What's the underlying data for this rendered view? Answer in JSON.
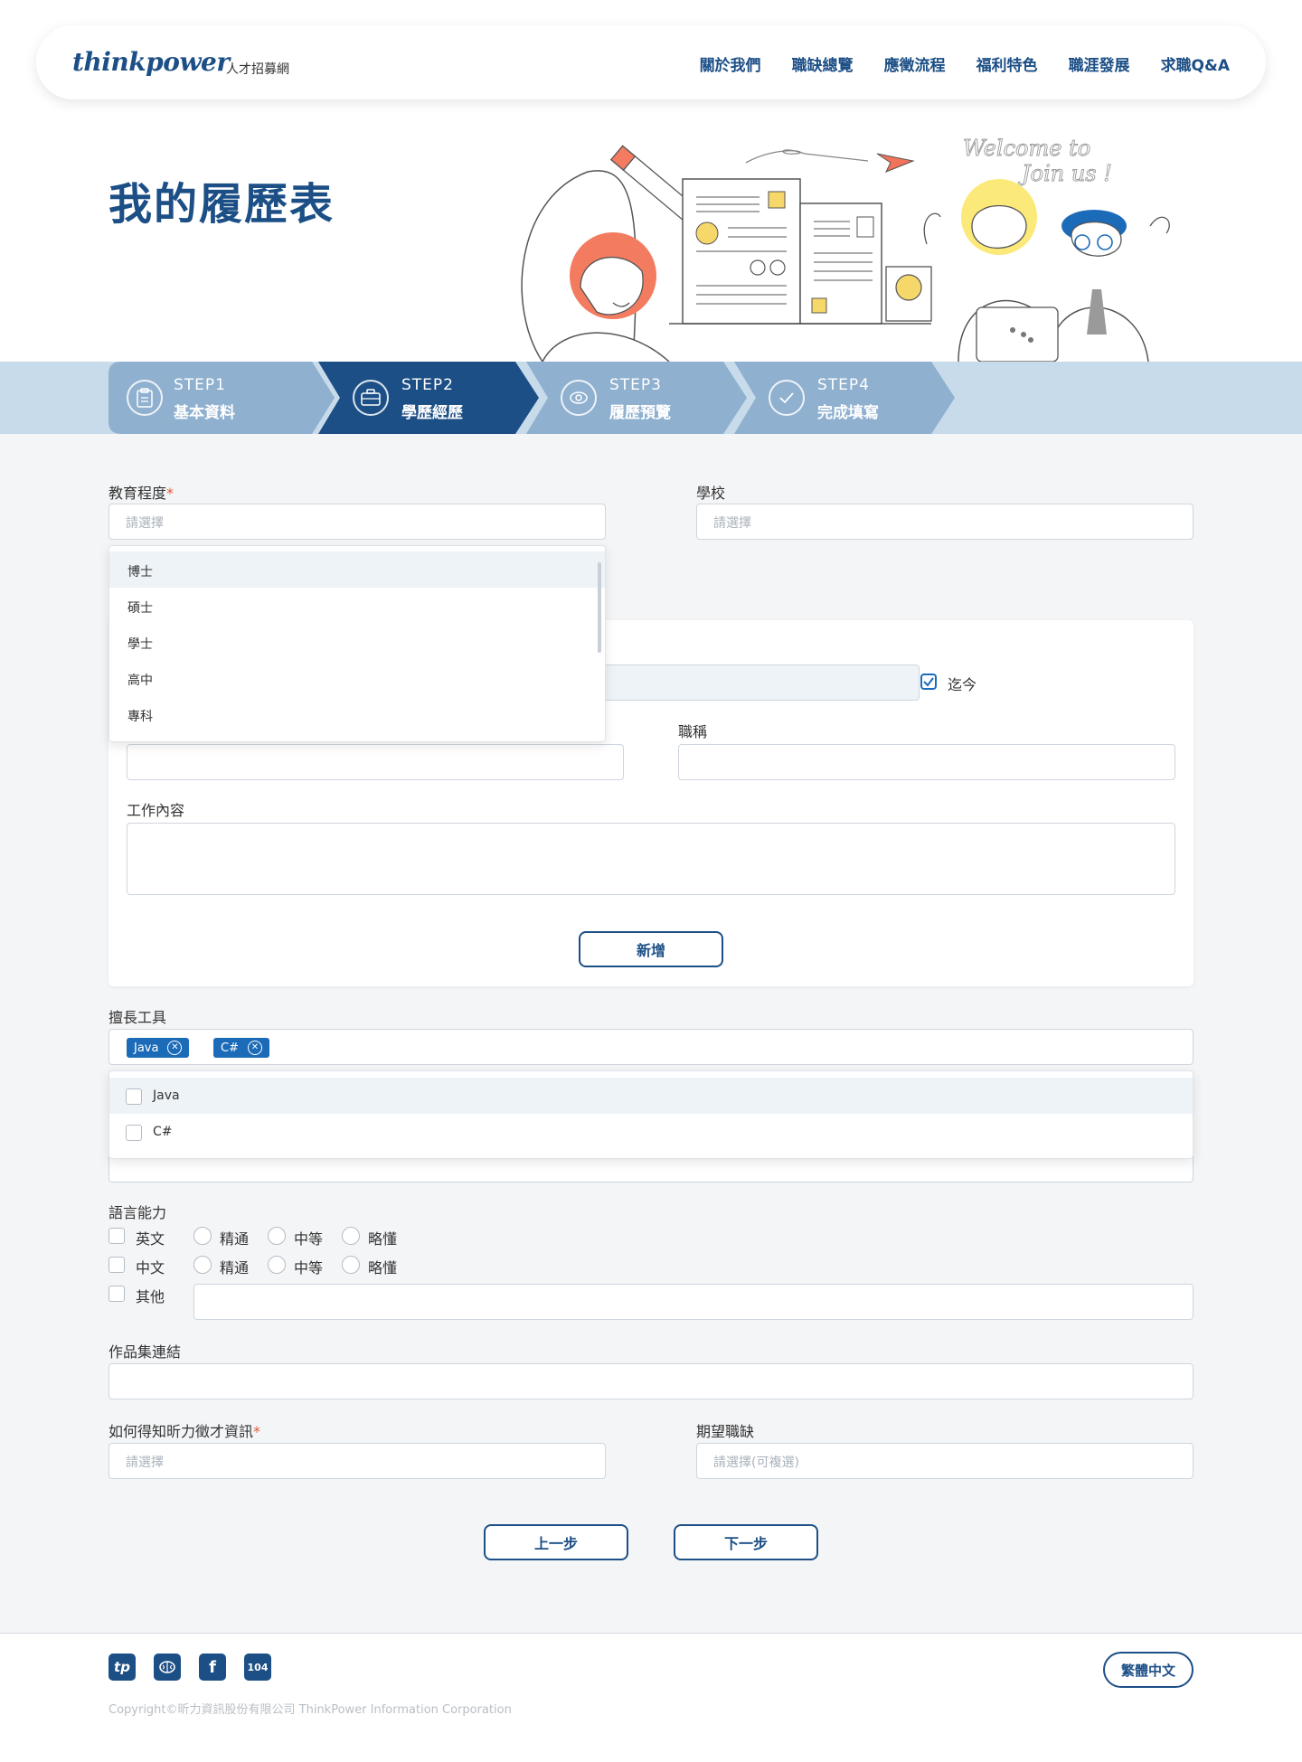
{
  "header": {
    "logo": "thinkpower",
    "logo_sub": "人才招募網",
    "nav": [
      "關於我們",
      "職缺總覽",
      "應徵流程",
      "福利特色",
      "職涯發展",
      "求職Q&A"
    ]
  },
  "hero": {
    "title": "我的履歷表",
    "welcome_line1": "Welcome to",
    "welcome_line2": "Join us !"
  },
  "steps": [
    {
      "label": "STEP1",
      "name": "基本資料",
      "icon": "clipboard-icon",
      "active": false
    },
    {
      "label": "STEP2",
      "name": "學歷經歷",
      "icon": "briefcase-icon",
      "active": true
    },
    {
      "label": "STEP3",
      "name": "履歷預覽",
      "icon": "eye-icon",
      "active": false
    },
    {
      "label": "STEP4",
      "name": "完成填寫",
      "icon": "check-icon",
      "active": false
    }
  ],
  "education": {
    "label": "教育程度",
    "required_mark": "*",
    "placeholder": "請選擇",
    "options": [
      "博士",
      "碩士",
      "學士",
      "高中",
      "專科"
    ]
  },
  "school": {
    "label": "學校",
    "placeholder": "請選擇"
  },
  "experience": {
    "until_now": "迄今",
    "title_label": "職稱",
    "content_label": "工作內容",
    "add_button": "新增"
  },
  "tools": {
    "label": "擅長工具",
    "selected": [
      "Java",
      "C#"
    ],
    "options": [
      "Java",
      "C#"
    ]
  },
  "language": {
    "label": "語言能力",
    "rows": [
      {
        "name": "英文",
        "levels": [
          "精通",
          "中等",
          "略懂"
        ]
      },
      {
        "name": "中文",
        "levels": [
          "精通",
          "中等",
          "略懂"
        ]
      }
    ],
    "other": "其他"
  },
  "portfolio": {
    "label": "作品集連結"
  },
  "source": {
    "label": "如何得知昕力徵才資訊",
    "required_mark": "*",
    "placeholder": "請選擇"
  },
  "expected": {
    "label": "期望職缺",
    "placeholder": "請選擇(可複選)"
  },
  "buttons": {
    "prev": "上一步",
    "next": "下一步"
  },
  "footer": {
    "socials": [
      "tp",
      "brain-icon",
      "f",
      "104"
    ],
    "copyright": "Copyright©昕力資訊股份有限公司 ThinkPower Information Corporation",
    "language": "繁體中文"
  },
  "colors": {
    "brand": "#1c4f86",
    "accent": "#1c6bb8",
    "required": "#e05a3a",
    "step_inactive": "#8fb0cf",
    "step_bar": "#c7dbea"
  }
}
